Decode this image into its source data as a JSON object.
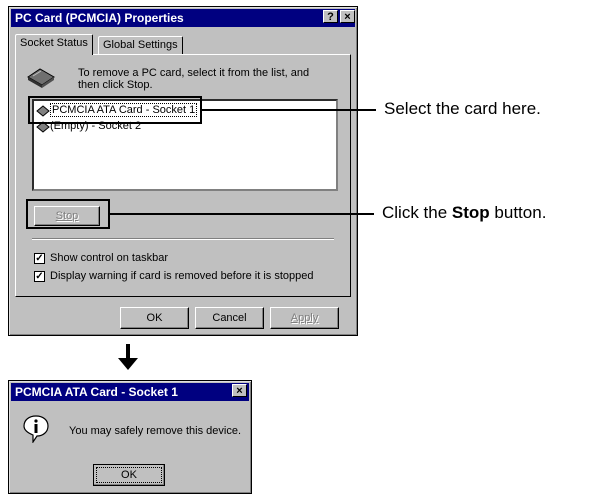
{
  "properties_dialog": {
    "title": "PC Card (PCMCIA) Properties",
    "help_button": "?",
    "close_button": "×",
    "tabs": [
      "Socket Status",
      "Global Settings"
    ],
    "instruction": "To remove a PC card, select it from the list, and then click Stop.",
    "cards": [
      "PCMCIA ATA Card - Socket 1",
      "(Empty) - Socket 2"
    ],
    "stop_label": "Stop",
    "checkboxes": [
      {
        "label": "Show control on taskbar",
        "checked": true
      },
      {
        "label": "Display warning if card is removed before it is stopped",
        "checked": true
      }
    ],
    "ok_label": "OK",
    "cancel_label": "Cancel",
    "apply_label": "Apply"
  },
  "callouts": {
    "select_card": "Select the card here.",
    "stop_prefix": "Click the ",
    "stop_bold": "Stop",
    "stop_suffix": " button."
  },
  "arrow": "↓",
  "message_dialog": {
    "title": "PCMCIA ATA Card - Socket 1",
    "close_button": "×",
    "message": "You may safely remove this device.",
    "ok_label": "OK"
  },
  "colors": {
    "titlebar": "#000080",
    "face": "#c0c0c0",
    "highlight": "#000000"
  }
}
